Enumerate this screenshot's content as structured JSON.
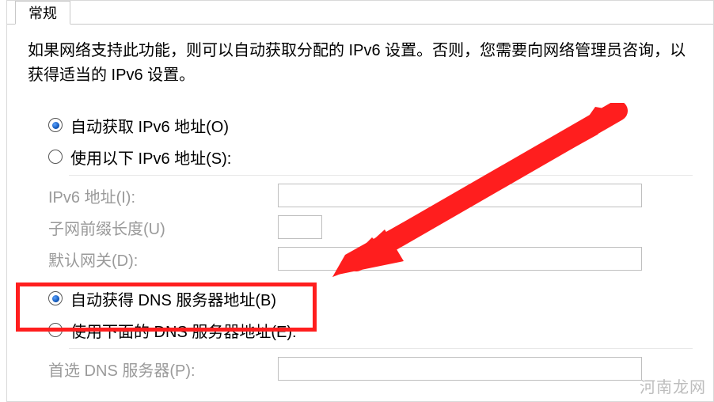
{
  "tab": {
    "label": "常规"
  },
  "description": "如果网络支持此功能，则可以自动获取分配的 IPv6 设置。否则，您需要向网络管理员咨询，以获得适当的 IPv6 设置。",
  "ipv6": {
    "autoLabel": "自动获取 IPv6 地址(O)",
    "manualLabel": "使用以下 IPv6 地址(S):",
    "addressLabel": "IPv6 地址(I):",
    "prefixLabel": "子网前缀长度(U)",
    "gatewayLabel": "默认网关(D):"
  },
  "dns": {
    "autoLabel": "自动获得 DNS 服务器地址(B)",
    "manualLabel": "使用下面的 DNS 服务器地址(E):",
    "preferredLabel": "首选 DNS 服务器(P):"
  },
  "watermark": "河南龙网"
}
